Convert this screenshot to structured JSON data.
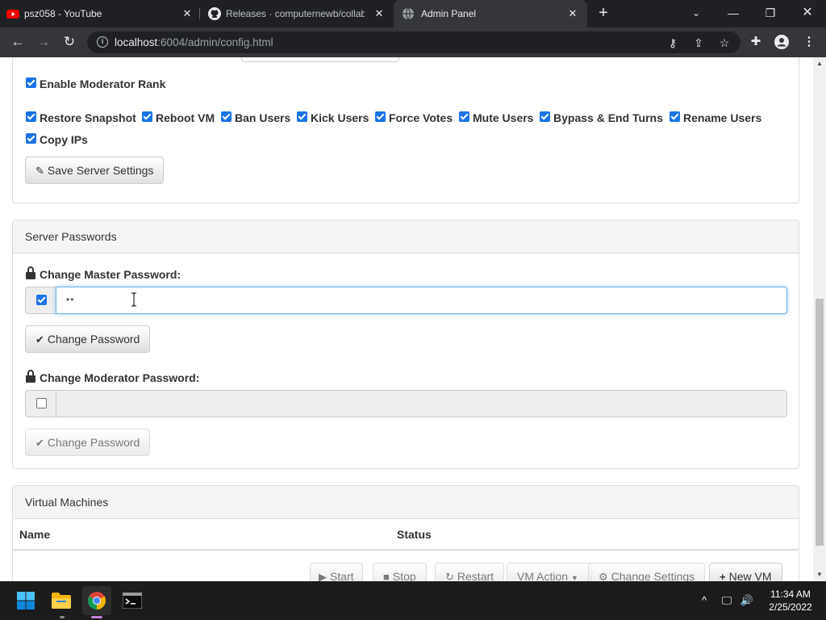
{
  "browser": {
    "tabs": [
      {
        "title": "psz058 - YouTube",
        "favicon": "youtube-icon",
        "active": false
      },
      {
        "title": "Releases · computernewb/collab-",
        "favicon": "github-icon",
        "active": false
      },
      {
        "title": "Admin Panel",
        "favicon": "globe-icon",
        "active": true
      }
    ],
    "url_host": "localhost",
    "url_rest": ":6004/admin/config.html"
  },
  "page": {
    "moderator": {
      "enable_label": "Enable Moderator Rank",
      "permissions": [
        {
          "label": "Restore Snapshot",
          "checked": true
        },
        {
          "label": "Reboot VM",
          "checked": true
        },
        {
          "label": "Ban Users",
          "checked": true
        },
        {
          "label": "Kick Users",
          "checked": true
        },
        {
          "label": "Force Votes",
          "checked": true
        },
        {
          "label": "Mute Users",
          "checked": true
        },
        {
          "label": "Bypass & End Turns",
          "checked": true
        },
        {
          "label": "Rename Users",
          "checked": true
        },
        {
          "label": "Copy IPs",
          "checked": true
        }
      ],
      "save_button": "Save Server Settings"
    },
    "passwords": {
      "heading": "Server Passwords",
      "master_label": "Change Master Password:",
      "master_value": "••",
      "master_enabled": true,
      "master_button": "Change Password",
      "moderator_label": "Change Moderator Password:",
      "moderator_value": "",
      "moderator_enabled": false,
      "moderator_button": "Change Password"
    },
    "vms": {
      "heading": "Virtual Machines",
      "columns": [
        "Name",
        "Status"
      ],
      "buttons": {
        "start": "Start",
        "stop": "Stop",
        "restart": "Restart",
        "vm_action": "VM Action",
        "change_settings": "Change Settings",
        "new_vm": "New VM"
      }
    }
  },
  "taskbar": {
    "time": "11:34 AM",
    "date": "2/25/2022",
    "apps": [
      "windows-start-icon",
      "file-explorer-icon",
      "chrome-icon",
      "terminal-icon"
    ]
  },
  "colors": {
    "accent": "#1a73e8",
    "panel_heading_bg": "#f5f5f5",
    "chrome_dark": "#202124",
    "chrome_toolbar": "#35363a"
  }
}
